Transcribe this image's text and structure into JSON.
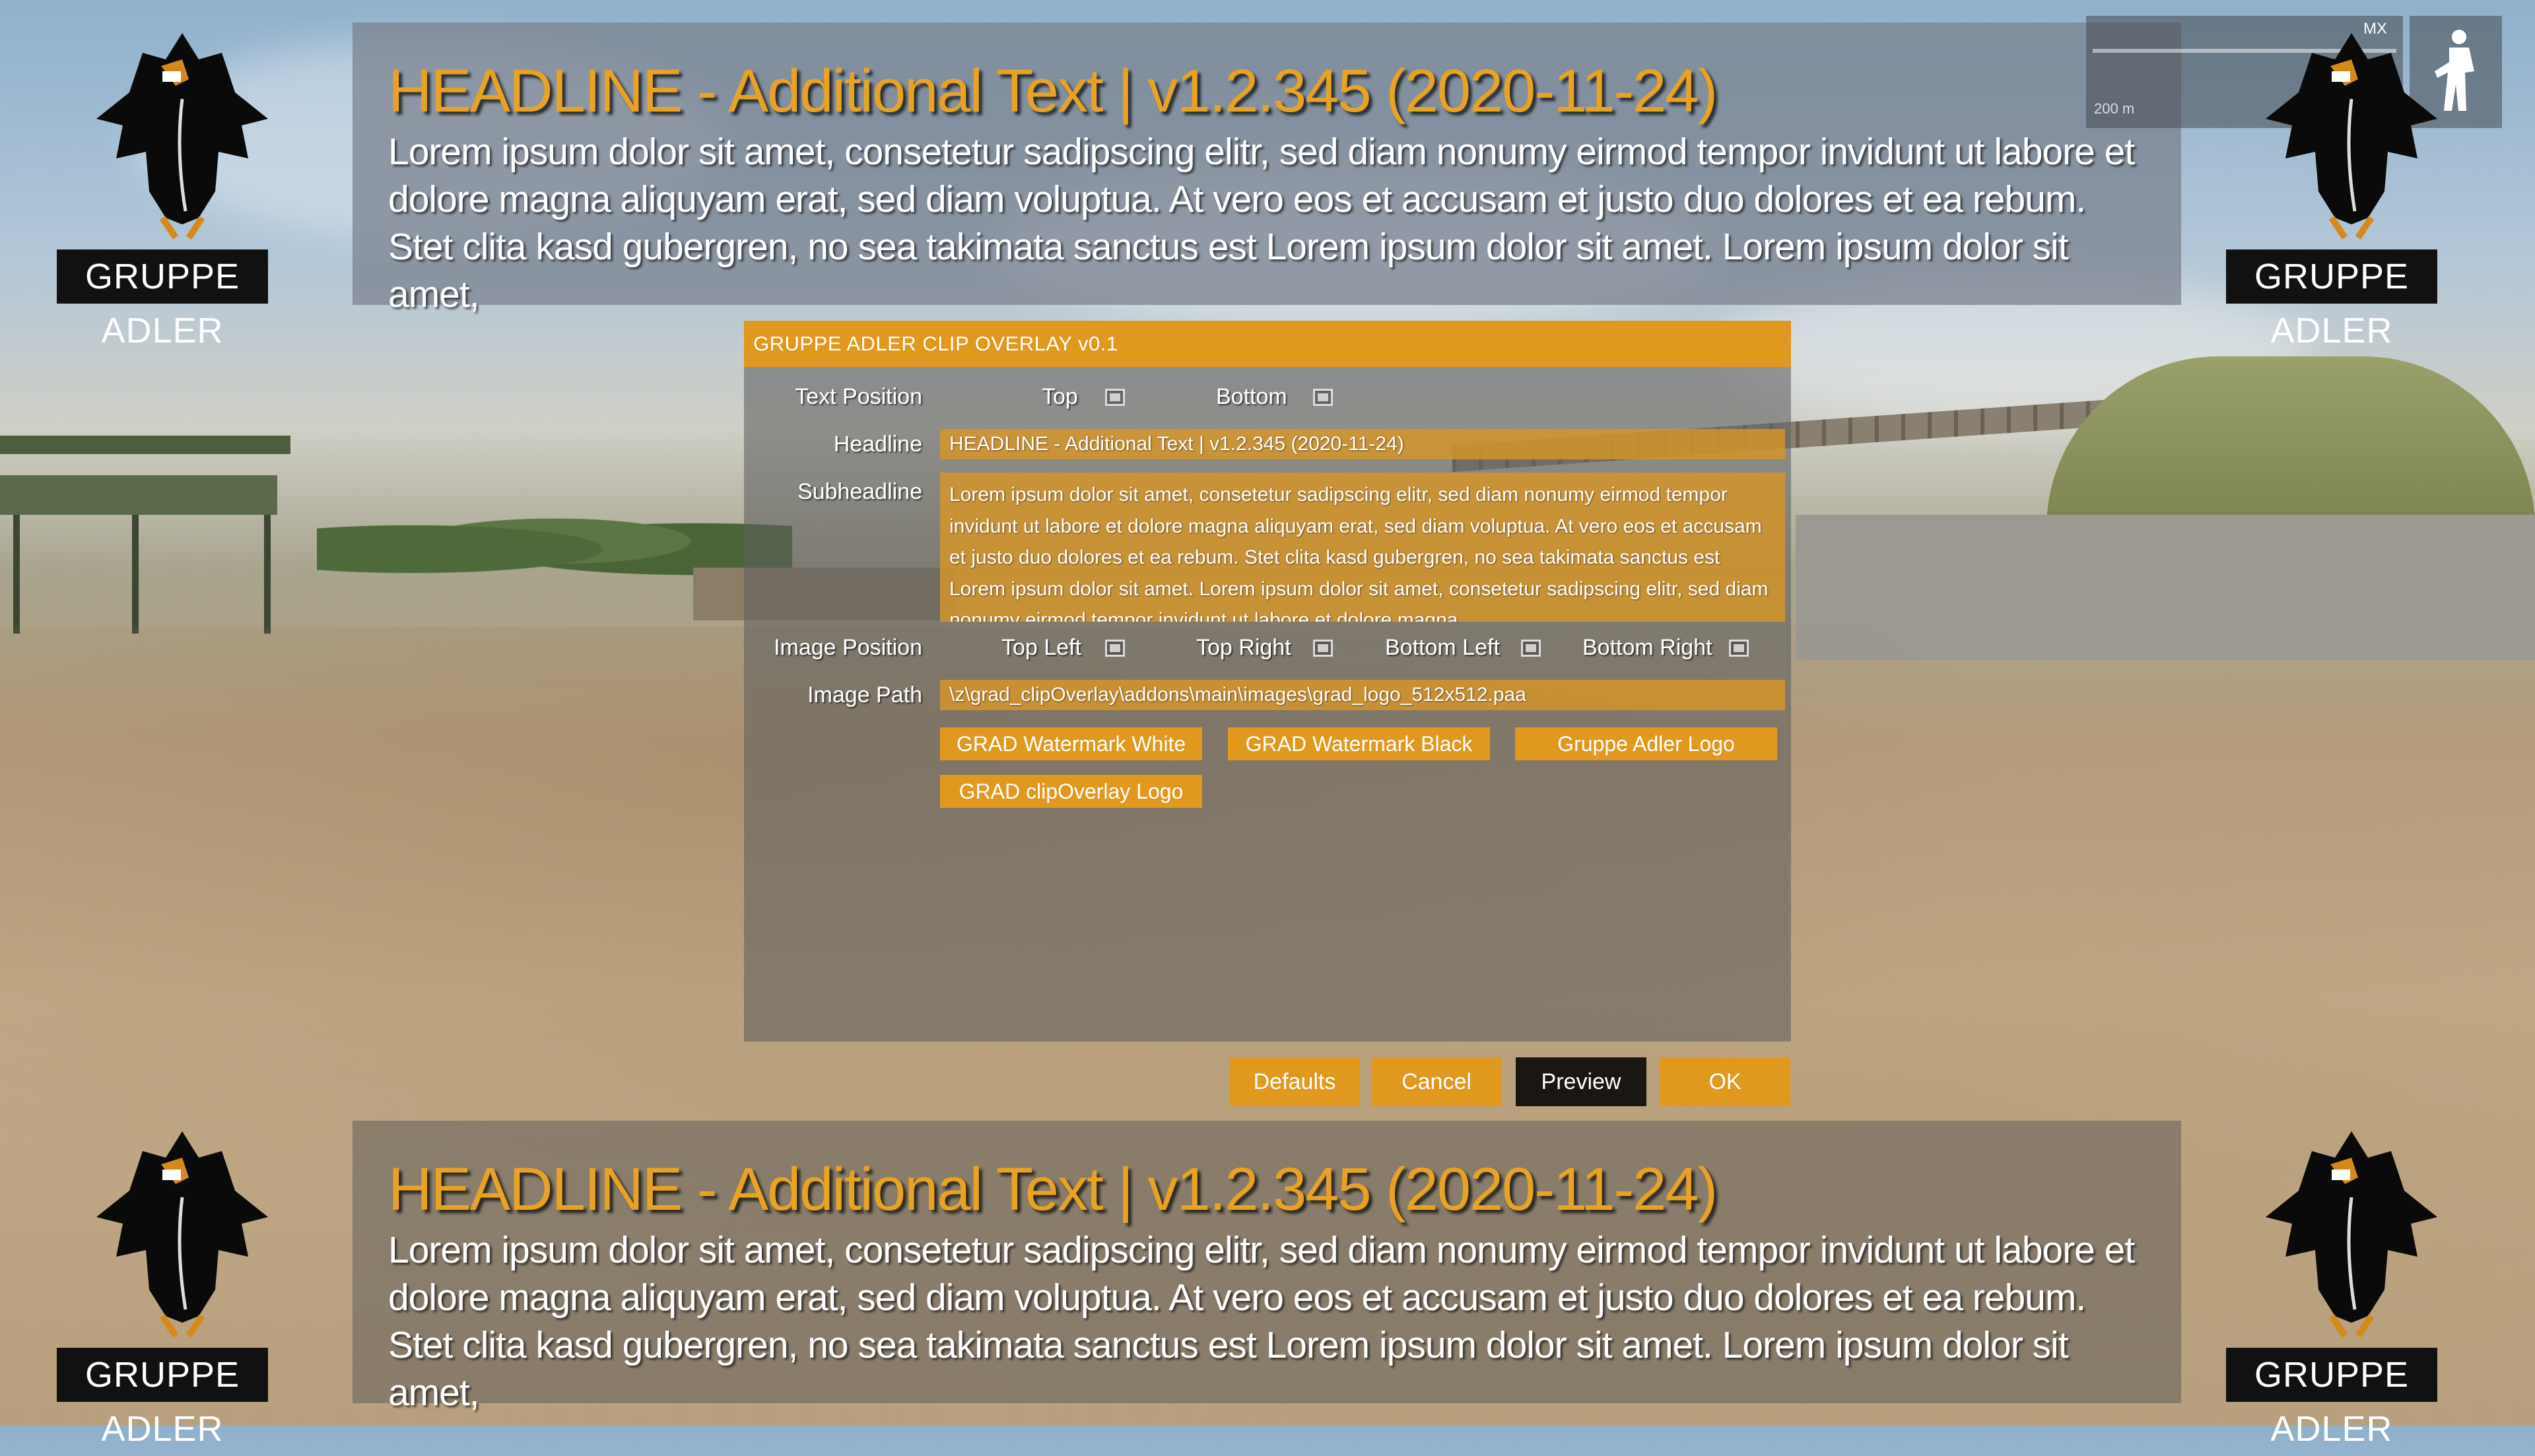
{
  "banner_top": {
    "headline": "HEADLINE - Additional Text | v1.2.345 (2020-11-24)",
    "subheadline": "Lorem ipsum dolor sit amet, consetetur sadipscing elitr, sed diam nonumy eirmod tempor invidunt ut labore et dolore magna aliquyam erat, sed diam voluptua. At vero eos et accusam et justo duo dolores et ea rebum. Stet clita kasd gubergren, no sea takimata sanctus est Lorem ipsum dolor sit amet. Lorem ipsum dolor sit amet,"
  },
  "banner_bottom": {
    "headline": "HEADLINE - Additional Text | v1.2.345 (2020-11-24)",
    "subheadline": "Lorem ipsum dolor sit amet, consetetur sadipscing elitr, sed diam nonumy eirmod tempor invidunt ut labore et dolore magna aliquyam erat, sed diam voluptua. At vero eos et accusam et justo duo dolores et ea rebum. Stet clita kasd gubergren, no sea takimata sanctus est Lorem ipsum dolor sit amet. Lorem ipsum dolor sit amet,"
  },
  "logo": {
    "label": "GRUPPE ADLER",
    "icon": "eagle-icon"
  },
  "hud": {
    "mode": "MX",
    "range": "200 m"
  },
  "dialog": {
    "title": "GRUPPE ADLER CLIP OVERLAY v0.1",
    "text_position": {
      "label": "Text Position",
      "options": [
        "Top",
        "Bottom"
      ]
    },
    "headline": {
      "label": "Headline",
      "value": "HEADLINE - Additional Text | v1.2.345 (2020-11-24)"
    },
    "subheadline": {
      "label": "Subheadline",
      "value": "Lorem ipsum dolor sit amet, consetetur sadipscing elitr, sed diam nonumy eirmod tempor invidunt ut labore et dolore magna aliquyam erat, sed diam voluptua. At vero eos et accusam et justo duo dolores et ea rebum. Stet clita kasd gubergren, no sea takimata sanctus est Lorem ipsum dolor sit amet. Lorem ipsum dolor sit amet, consetetur sadipscing elitr, sed diam nonumy eirmod tempor invidunt ut labore et dolore magna"
    },
    "image_position": {
      "label": "Image Position",
      "options": [
        "Top Left",
        "Top Right",
        "Bottom Left",
        "Bottom Right"
      ]
    },
    "image_path": {
      "label": "Image Path",
      "value": "\\z\\grad_clipOverlay\\addons\\main\\images\\grad_logo_512x512.paa"
    },
    "presets": [
      "GRAD Watermark White",
      "GRAD Watermark Black",
      "Gruppe Adler Logo",
      "GRAD clipOverlay Logo"
    ]
  },
  "footer": {
    "defaults": "Defaults",
    "cancel": "Cancel",
    "preview": "Preview",
    "ok": "OK"
  },
  "colors": {
    "accent": "#e0981e",
    "headline": "#e8a325",
    "active_button": "#1a1611"
  }
}
